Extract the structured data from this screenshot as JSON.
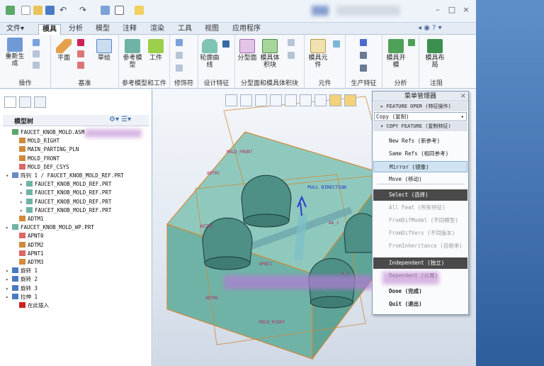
{
  "menu_tabs": [
    "文件",
    "模具",
    "分析",
    "模型",
    "注释",
    "渲染",
    "工具",
    "视图",
    "应用程序"
  ],
  "ribbon": {
    "groups": [
      "操作",
      "基准",
      "参考模型和工件",
      "修饰符",
      "设计特征",
      "分型面和模具体积块",
      "元件",
      "生产特征",
      "分析",
      "注阻"
    ],
    "buttons": {
      "regen": "重新生成",
      "plane": "平面",
      "sketch": "草绘",
      "ref_model": "参考模型",
      "workpiece": "工件",
      "profile_curve": "轮廓曲线",
      "parting_surface": "分型面",
      "mold_volume": "模具体积块",
      "mold_component": "模具元件",
      "mold_open": "模具开模",
      "mold_layout": "模具布局"
    }
  },
  "tree": {
    "title": "模型树",
    "items": [
      "FAUCET_KNOB_MOLD.ASM",
      "MOLD_RIGHT",
      "MAIN_PARTING_PLN",
      "MOLD_FRONT",
      "MOLD_DEF_CSYS",
      "阵列 1 / FAUCET_KNOB_MOLD_REF.PRT",
      "FAUCET_KNOB_MOLD_REF.PRT",
      "FAUCET_KNOB_MOLD_REF.PRT",
      "FAUCET_KNOB_MOLD_REF.PRT",
      "FAUCET_KNOB_MOLD_REF.PRT",
      "ADTM1",
      "FAUCET_KNOB_MOLD_WP.PRT",
      "APNT0",
      "ADTM2",
      "APNT1",
      "ADTM3",
      "旋转 1",
      "旋转 2",
      "旋转 3",
      "拉伸 1",
      "在此插入"
    ]
  },
  "viewport": {
    "labels": [
      "MOLD_FRONT",
      "PULL DIRECTION",
      "ADTM2",
      "ADTM1",
      "APNT1",
      "AA_1",
      "A_1",
      "ADTM3",
      "MOLD_RIGHT"
    ]
  },
  "menu_manager": {
    "title": "菜单管理器",
    "section1": "FEATURE OPER (特征操作)",
    "copy_select": "Copy  (复制)",
    "section2": "COPY FEATURE (复制特征)",
    "items": [
      "New Refs (新参考)",
      "Same Refs (相同参考)",
      "Mirror (镜像)",
      "Move (移动)",
      "Select (选择)",
      "All Feat (所有特征)",
      "FromDifModel (不同模型)",
      "FromDifVers (不同版本)",
      "FromInheritance (自继承)",
      "Independent (独立)",
      "Dependent (从属)",
      "Done (完成)",
      "Quit (退出)"
    ],
    "states": [
      "normal",
      "normal",
      "selected",
      "normal",
      "dark",
      "disabled",
      "disabled",
      "disabled",
      "disabled",
      "dark",
      "normal",
      "normal",
      "normal"
    ]
  },
  "colors": {
    "mold_fill": "#6fb3a7",
    "mold_edge": "#d08a3a",
    "knob": "#4e8f86",
    "accent": "#3a6aa6"
  }
}
